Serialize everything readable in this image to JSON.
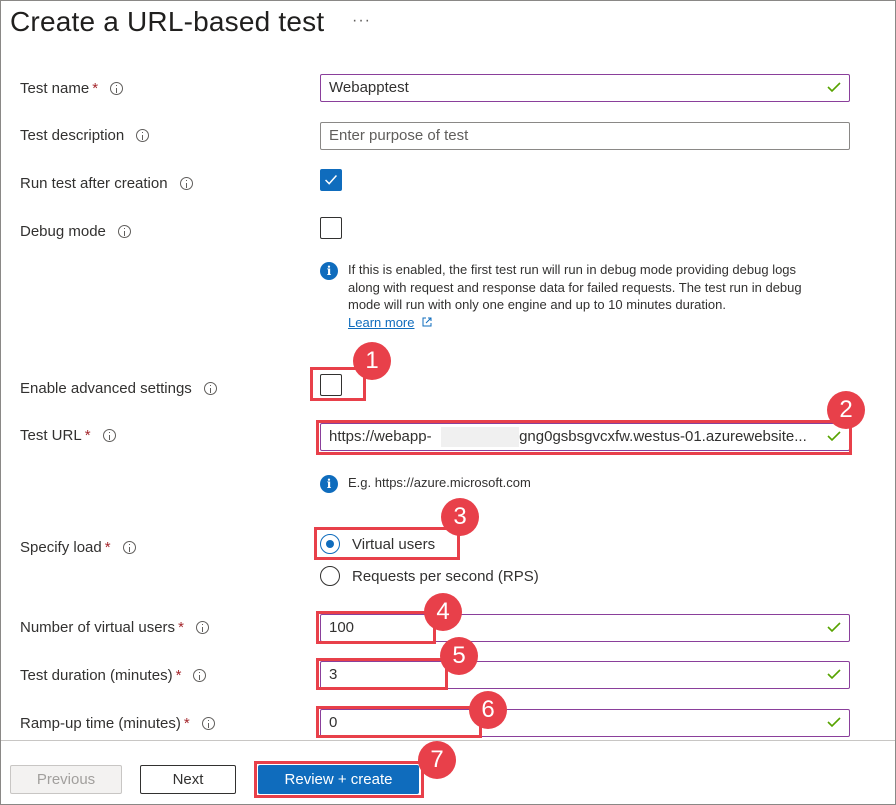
{
  "title": "Create a URL-based test",
  "more": "···",
  "fields": {
    "test_name": {
      "label": "Test name",
      "value": "Webapptest"
    },
    "test_description": {
      "label": "Test description",
      "placeholder": "Enter purpose of test"
    },
    "run_after_creation": {
      "label": "Run test after creation",
      "checked": true
    },
    "debug_mode": {
      "label": "Debug mode",
      "checked": false
    },
    "debug_info": "If this is enabled, the first test run will run in debug mode providing debug logs along with request and response data for failed requests. The test run in debug mode will run with only one engine and up to 10 minutes duration.",
    "learn_more": "Learn more",
    "enable_advanced": {
      "label": "Enable advanced settings",
      "checked": false
    },
    "test_url": {
      "label": "Test URL",
      "value": "https://webapp-                   ugng0gsbsgvcxfw.westus-01.azurewebsite..."
    },
    "url_example": "E.g. https://azure.microsoft.com",
    "specify_load": {
      "label": "Specify load",
      "options": [
        "Virtual users",
        "Requests per second (RPS)"
      ],
      "selected": "Virtual users"
    },
    "virtual_users": {
      "label": "Number of virtual users",
      "value": "100"
    },
    "duration": {
      "label": "Test duration (minutes)",
      "value": "3"
    },
    "ramp_up": {
      "label": "Ramp-up time (minutes)",
      "value": "0"
    }
  },
  "required_marker": "*",
  "buttons": {
    "previous": "Previous",
    "next": "Next",
    "create": "Review + create"
  },
  "badges": [
    "1",
    "2",
    "3",
    "4",
    "5",
    "6",
    "7"
  ],
  "colors": {
    "accent": "#0f6cbd",
    "highlight": "#e8404a",
    "valid_border": "#8a3f9b",
    "check": "#57a300"
  }
}
